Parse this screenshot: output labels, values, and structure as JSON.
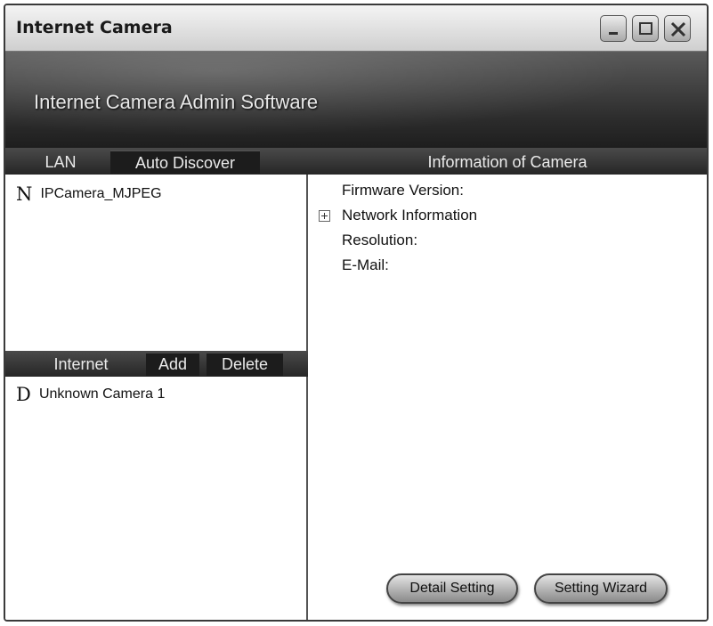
{
  "window": {
    "title": "Internet Camera"
  },
  "banner": {
    "title": "Internet Camera Admin Software"
  },
  "tabs": {
    "lan": "LAN",
    "auto_discover": "Auto Discover",
    "info": "Information of Camera"
  },
  "lan_list": [
    {
      "letter": "N",
      "name": "IPCamera_MJPEG"
    }
  ],
  "internet_bar": {
    "label": "Internet",
    "add": "Add",
    "delete": "Delete"
  },
  "internet_list": [
    {
      "letter": "D",
      "name": "Unknown Camera 1"
    }
  ],
  "info": {
    "firmware": "Firmware Version:",
    "network": "Network Information",
    "resolution": "Resolution:",
    "email": "E-Mail:"
  },
  "buttons": {
    "detail": "Detail Setting",
    "wizard": "Setting Wizard"
  }
}
